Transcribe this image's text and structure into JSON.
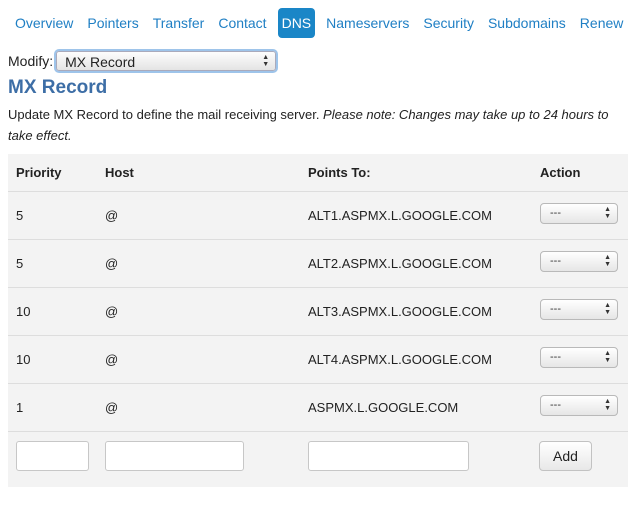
{
  "nav": {
    "tabs": [
      {
        "label": "Overview"
      },
      {
        "label": "Pointers"
      },
      {
        "label": "Transfer"
      },
      {
        "label": "Contact"
      },
      {
        "label": "DNS"
      },
      {
        "label": "Nameservers"
      },
      {
        "label": "Security"
      },
      {
        "label": "Subdomains"
      },
      {
        "label": "Renew"
      }
    ],
    "active_tab": "DNS"
  },
  "modify": {
    "label": "Modify:",
    "selected": "MX Record"
  },
  "page": {
    "title": "MX Record",
    "description": "Update MX Record to define the mail receiving server. ",
    "note": "Please note: Changes may take up to 24 hours to take effect."
  },
  "table": {
    "headers": {
      "priority": "Priority",
      "host": "Host",
      "points_to": "Points To:",
      "action": "Action"
    },
    "rows": [
      {
        "priority": "5",
        "host": "@",
        "points_to": "ALT1.ASPMX.L.GOOGLE.COM",
        "action": "---"
      },
      {
        "priority": "5",
        "host": "@",
        "points_to": "ALT2.ASPMX.L.GOOGLE.COM",
        "action": "---"
      },
      {
        "priority": "10",
        "host": "@",
        "points_to": "ALT3.ASPMX.L.GOOGLE.COM",
        "action": "---"
      },
      {
        "priority": "10",
        "host": "@",
        "points_to": "ALT4.ASPMX.L.GOOGLE.COM",
        "action": "---"
      },
      {
        "priority": "1",
        "host": "@",
        "points_to": "ASPMX.L.GOOGLE.COM",
        "action": "---"
      }
    ]
  },
  "add_form": {
    "priority_value": "",
    "host_value": "",
    "points_to_value": "",
    "add_label": "Add"
  },
  "colors": {
    "accent": "#1a86c7",
    "link": "#1f7fc4",
    "title": "#3d6ea6",
    "panel_bg": "#f3f3f3"
  }
}
